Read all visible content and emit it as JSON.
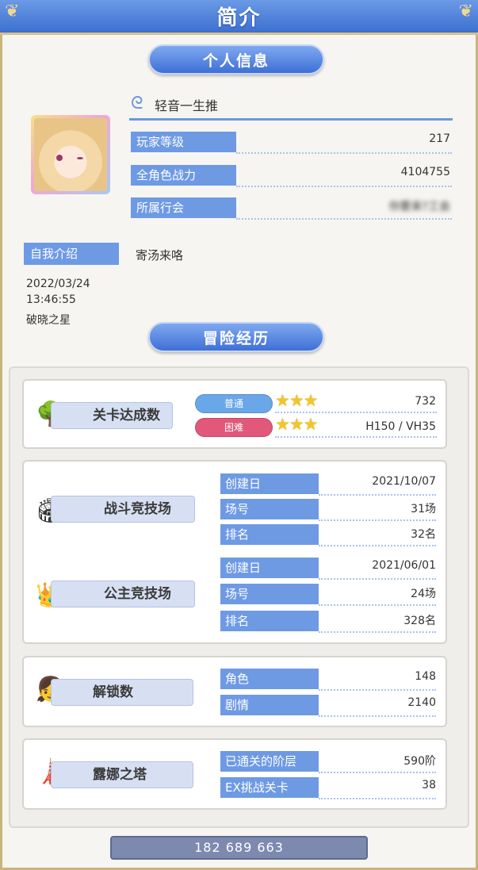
{
  "title": "简介",
  "sections": {
    "personal_info": "个人信息",
    "adventure": "冒险经历"
  },
  "profile": {
    "username": "轻音一生推",
    "rows": [
      {
        "label": "玩家等级",
        "value": "217"
      },
      {
        "label": "全角色战力",
        "value": "4104755"
      },
      {
        "label": "所属行会",
        "value": "你要来?工会"
      }
    ],
    "self_intro_label": "自我介绍",
    "self_intro_value": "寄汤来咯",
    "date": "2022/03/24",
    "time": "13:46:55",
    "title_badge": "破晓之星"
  },
  "quests": {
    "category": "关卡达成数",
    "normal_label": "普通",
    "hard_label": "困难",
    "normal_value": "732",
    "hard_value": "H150 / VH35",
    "normal_stars": "★★★",
    "hard_stars": "★★★"
  },
  "battle_arena": {
    "category": "战斗竞技场",
    "rows": [
      {
        "label": "创建日",
        "value": "2021/10/07"
      },
      {
        "label": "场号",
        "value": "31场"
      },
      {
        "label": "排名",
        "value": "32名"
      }
    ]
  },
  "princess_arena": {
    "category": "公主竞技场",
    "rows": [
      {
        "label": "创建日",
        "value": "2021/06/01"
      },
      {
        "label": "场号",
        "value": "24场"
      },
      {
        "label": "排名",
        "value": "328名"
      }
    ]
  },
  "unlocks": {
    "category": "解锁数",
    "rows": [
      {
        "label": "角色",
        "value": "148"
      },
      {
        "label": "剧情",
        "value": "2140"
      }
    ]
  },
  "luna_tower": {
    "category": "露娜之塔",
    "rows": [
      {
        "label": "已通关的阶层",
        "value": "590阶"
      },
      {
        "label": "EX挑战关卡",
        "value": "38"
      }
    ]
  },
  "footer_id": "182 689 663",
  "colors": {
    "accent": "#6e9ae4",
    "normal_pill": "#6aa7e8",
    "hard_pill": "#e2587a",
    "star": "#f3c628"
  }
}
